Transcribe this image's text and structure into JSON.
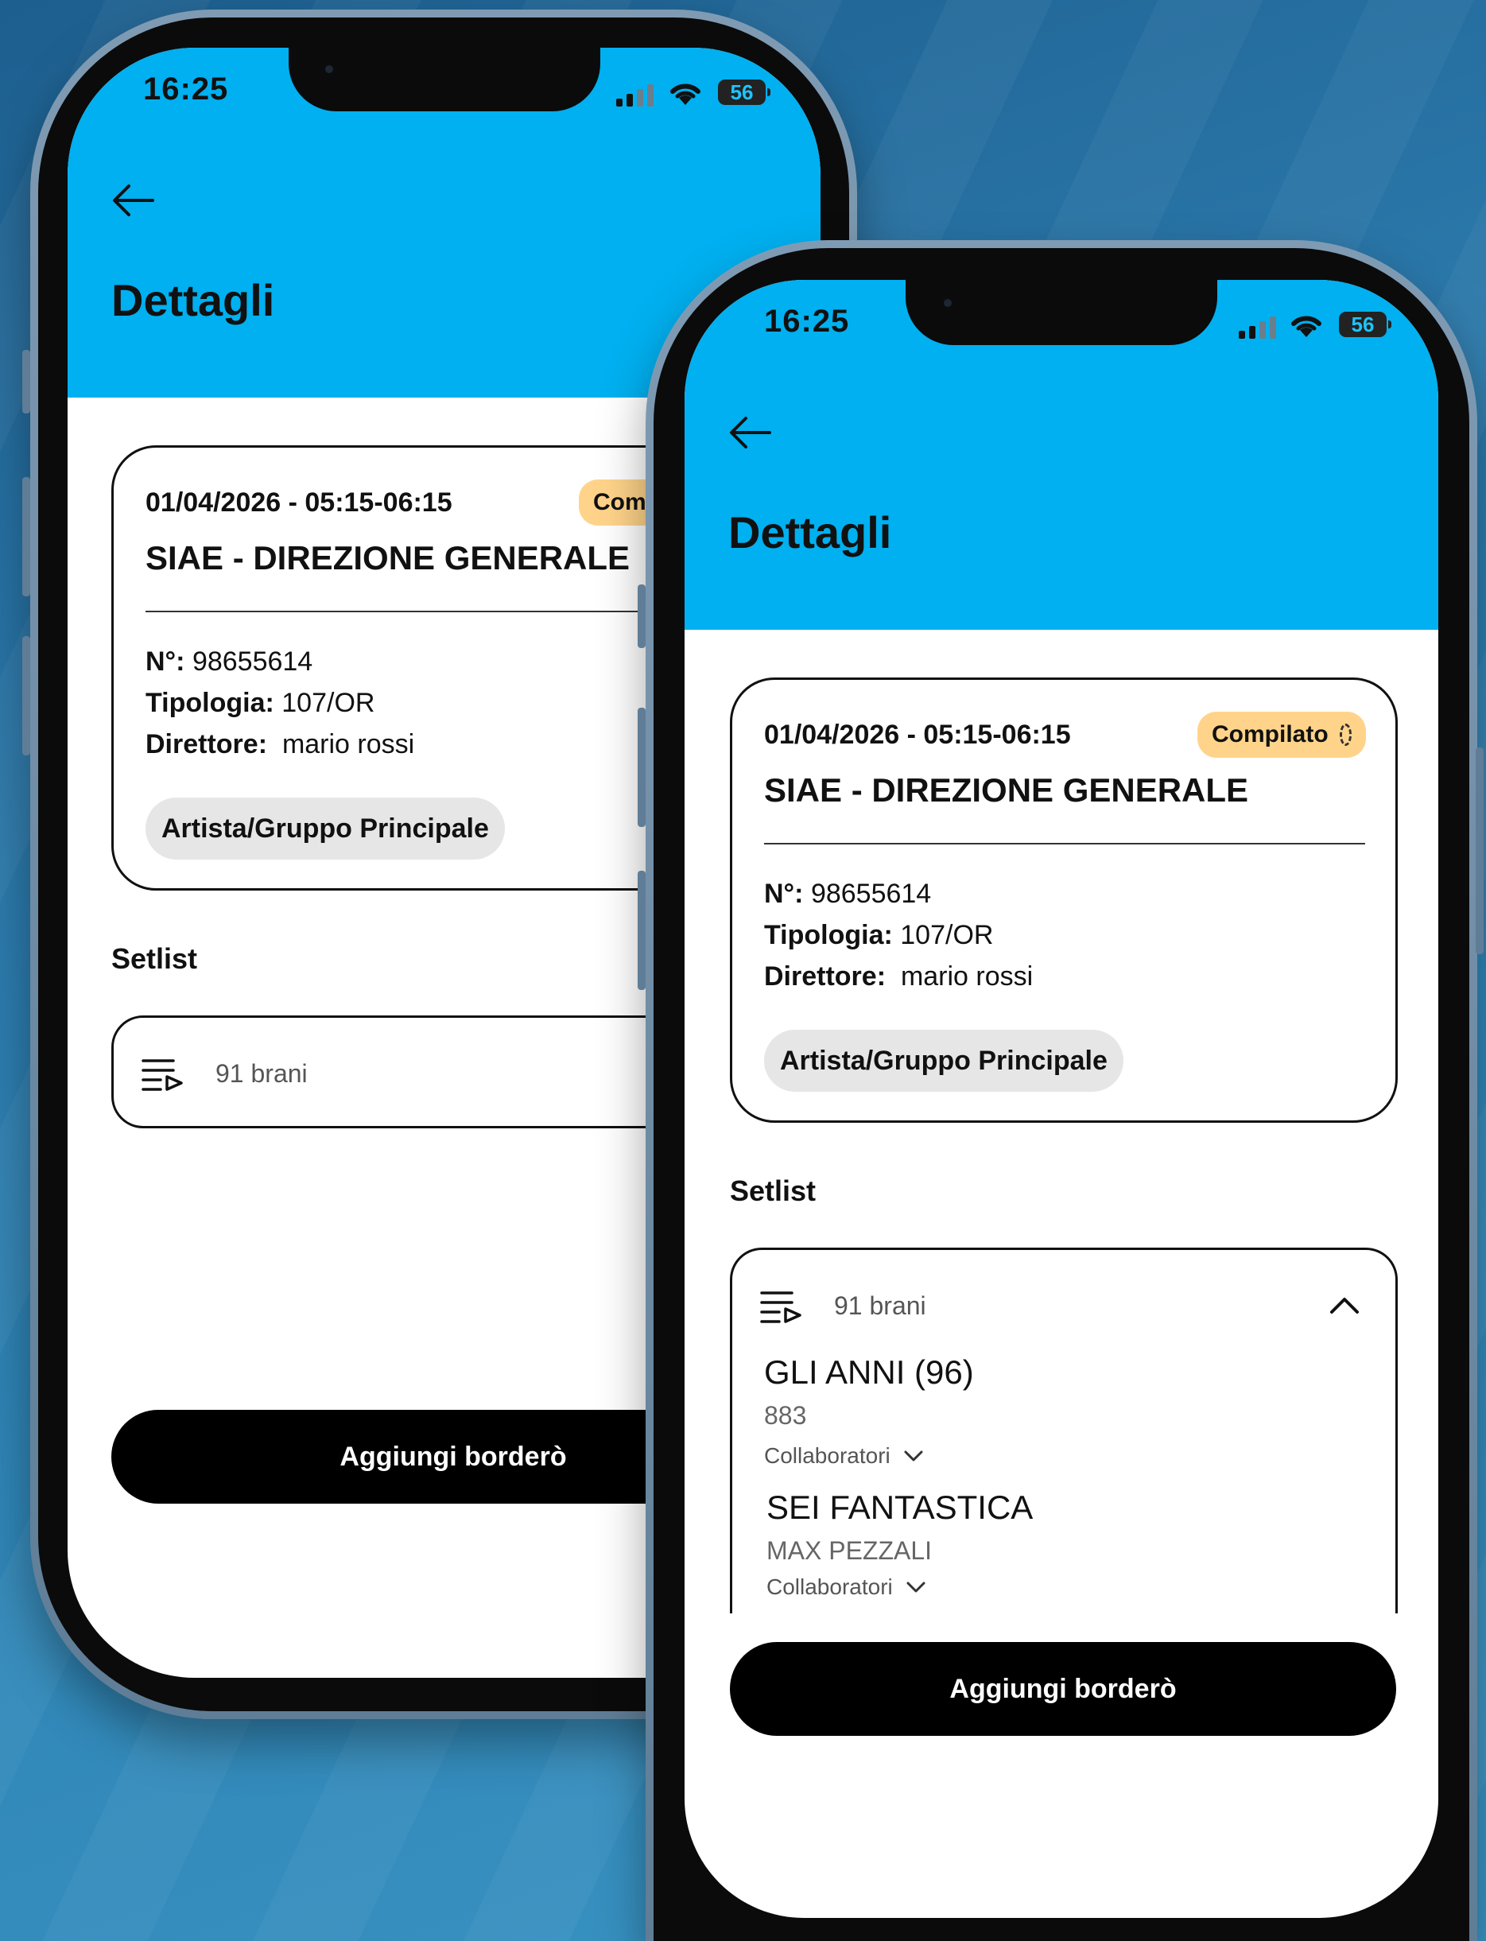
{
  "colors": {
    "header": "#00b0f0",
    "badge": "#ffd48a",
    "chip": "#e6e6e6",
    "button": "#000000",
    "background": "#2b79ab"
  },
  "phones": [
    {
      "status_bar": {
        "time": "16:25",
        "battery": "56"
      },
      "header": {
        "back_icon": "arrow-left-icon",
        "title": "Dettagli"
      },
      "card": {
        "datetime": "01/04/2026 - 05:15-06:15",
        "badge": "Comp",
        "venue": "SIAE - DIREZIONE GENERALE",
        "number_label": "N°:",
        "number_value": "98655614",
        "type_label": "Tipologia:",
        "type_value": "107/OR",
        "director_label": "Direttore:",
        "director_value": "mario rossi",
        "chip": "Artista/Gruppo Principale"
      },
      "setlist": {
        "section_title": "Setlist",
        "icon": "playlist-play-icon",
        "count": "91 brani"
      },
      "action_button": "Aggiungi borderò"
    },
    {
      "status_bar": {
        "time": "16:25",
        "battery": "56"
      },
      "header": {
        "back_icon": "arrow-left-icon",
        "title": "Dettagli"
      },
      "card": {
        "datetime": "01/04/2026 - 05:15-06:15",
        "badge": "Compilato",
        "badge_icon": "loading-circle-icon",
        "venue": "SIAE - DIREZIONE GENERALE",
        "number_label": "N°:",
        "number_value": "98655614",
        "type_label": "Tipologia:",
        "type_value": "107/OR",
        "director_label": "Direttore:",
        "director_value": "mario rossi",
        "chip": "Artista/Gruppo Principale"
      },
      "setlist": {
        "section_title": "Setlist",
        "icon": "playlist-play-icon",
        "count": "91 brani",
        "toggle_icon": "chevron-up-icon",
        "songs": [
          {
            "title": "GLI ANNI (96)",
            "artist": "883",
            "collaborators": "Collaboratori"
          },
          {
            "title": "SEI FANTASTICA",
            "artist": "MAX PEZZALI",
            "collaborators": "Collaboratori"
          }
        ]
      },
      "action_button": "Aggiungi borderò"
    }
  ]
}
